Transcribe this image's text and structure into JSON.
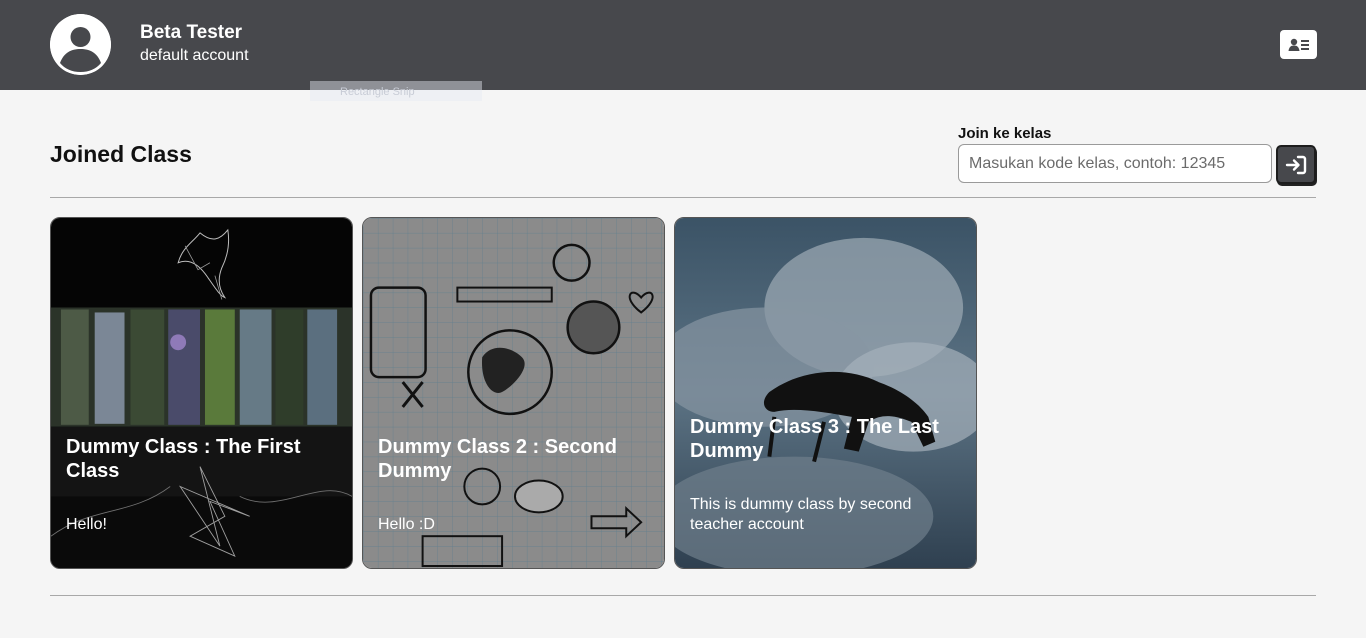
{
  "header": {
    "user_name": "Beta Tester",
    "user_subtitle": "default account",
    "ghost_tooltip": "Rectangle Snip"
  },
  "main": {
    "section_title": "Joined Class",
    "join": {
      "label": "Join ke kelas",
      "placeholder": "Masukan kode kelas, contoh: 12345",
      "value": ""
    },
    "classes": [
      {
        "title": "Dummy Class : The First Class",
        "description": "Hello!"
      },
      {
        "title": "Dummy Class 2 : Second Dummy",
        "description": "Hello :D"
      },
      {
        "title": "Dummy Class 3 : The Last Dummy",
        "description": "This is dummy class by second teacher account"
      }
    ]
  },
  "icons": {
    "avatar": "user-circle-icon",
    "profile": "id-card-icon",
    "join": "sign-in-icon"
  },
  "colors": {
    "header_bg": "#47484c",
    "page_bg": "#f5f5f5",
    "button_bg": "#47484c"
  }
}
